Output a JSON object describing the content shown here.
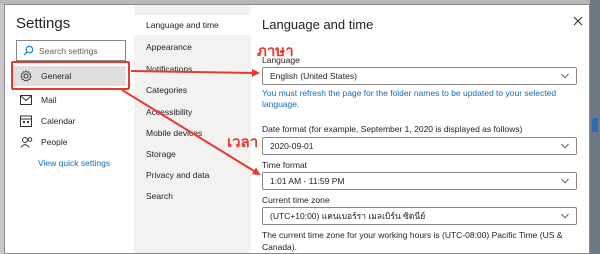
{
  "left": {
    "title": "Settings",
    "search_placeholder": "Search settings",
    "nav": [
      {
        "label": "General",
        "icon": "gear-icon"
      },
      {
        "label": "Mail",
        "icon": "mail-icon"
      },
      {
        "label": "Calendar",
        "icon": "calendar-icon"
      },
      {
        "label": "People",
        "icon": "people-icon"
      }
    ],
    "view_quick_settings": "View quick settings"
  },
  "middle": {
    "items": [
      "Language and time",
      "Appearance",
      "Notifications",
      "Categories",
      "Accessibility",
      "Mobile devices",
      "Storage",
      "Privacy and data",
      "Search"
    ],
    "active_index": 0
  },
  "right": {
    "title": "Language and time",
    "language_label": "Language",
    "language_value": "English (United States)",
    "refresh_notice": "You must refresh the page for the folder names to be updated to your selected language.",
    "date_format_label": "Date format (for example, September 1, 2020 is displayed as follows)",
    "date_format_value": "2020-09-01",
    "time_format_label": "Time format",
    "time_format_value": "1:01 AM - 11:59 PM",
    "time_zone_label": "Current time zone",
    "time_zone_value": "(UTC+10:00) แคนเบอร์รา เมลเบิร์น ซิดนีย์",
    "working_hours_note": "The current time zone for your working hours is (UTC-08:00) Pacific Time (US & Canada)."
  },
  "annotations": {
    "language_thai": "ภาษา",
    "time_thai": "เวลา",
    "color": "#e8392f"
  },
  "colors": {
    "accent": "#0f6cbd",
    "nav_active": "#e1dfdd",
    "middle_bg": "#f3f2f1"
  }
}
